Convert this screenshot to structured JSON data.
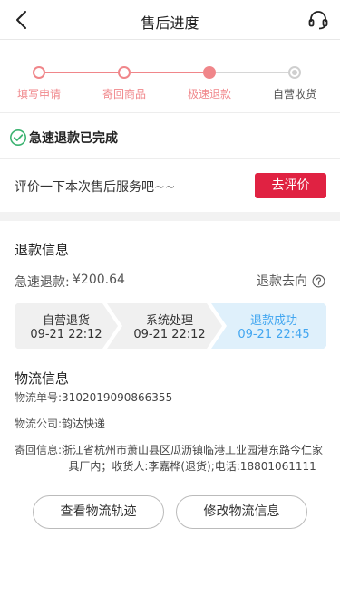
{
  "header": {
    "title": "售后进度"
  },
  "steps": [
    {
      "label": "填写申请",
      "state": "done"
    },
    {
      "label": "寄回商品",
      "state": "done"
    },
    {
      "label": "极速退款",
      "state": "current"
    },
    {
      "label": "自营收货",
      "state": "todo"
    }
  ],
  "status": {
    "text": "急速退款已完成"
  },
  "review": {
    "prompt": "评价一下本次售后服务吧~~",
    "button_label": "去评价"
  },
  "refund": {
    "section_title": "退款信息",
    "amount_label": "急速退款:",
    "amount_value": "¥200.64",
    "destination_label": "退款去向",
    "progress": [
      {
        "label": "自营退货",
        "time": "09-21 22:12",
        "active": false
      },
      {
        "label": "系统处理",
        "time": "09-21 22:12",
        "active": false
      },
      {
        "label": "退款成功",
        "time": "09-21 22:45",
        "active": true
      }
    ]
  },
  "logistics": {
    "section_title": "物流信息",
    "tracking_label": "物流单号:",
    "tracking_value": "3102019090866355",
    "company_label": "物流公司:",
    "company_value": "韵达快递",
    "address_label": "寄回信息:",
    "address_line1": "浙江省杭州市萧山县区瓜沥镇临港工业园港东路今仁家",
    "address_line2": "具厂内；收货人:李嘉桦(退货);电话:18801061111"
  },
  "actions": {
    "track_label": "查看物流轨迹",
    "modify_label": "修改物流信息"
  },
  "colors": {
    "step_accent": "#f0868a",
    "review_button": "#e02242",
    "progress_active": "#42a6f0",
    "check_green": "#3cb371"
  }
}
